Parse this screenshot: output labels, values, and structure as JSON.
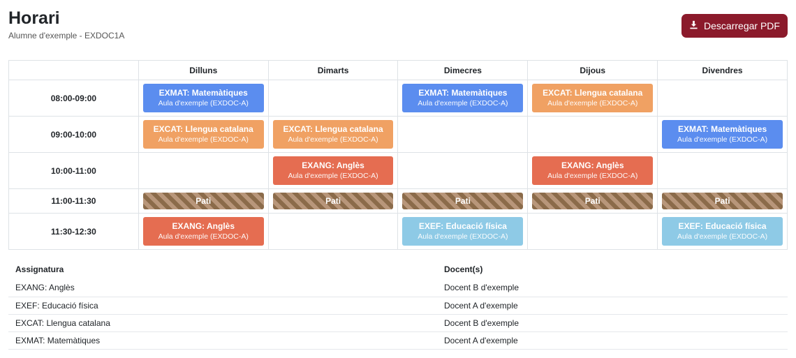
{
  "header": {
    "title": "Horari",
    "subtitle": "Alumne d'exemple - EXDOC1A",
    "download_label": "Descarregar PDF"
  },
  "days": [
    "Dilluns",
    "Dimarts",
    "Dimecres",
    "Dijous",
    "Divendres"
  ],
  "times": [
    "08:00-09:00",
    "09:00-10:00",
    "10:00-11:00",
    "11:00-11:30",
    "11:30-12:30"
  ],
  "cells": [
    [
      {
        "subject": "EXMAT: Matemàtiques",
        "room": "Aula d'exemple (EXDOC-A)"
      },
      null,
      {
        "subject": "EXMAT: Matemàtiques",
        "room": "Aula d'exemple (EXDOC-A)"
      },
      {
        "subject": "EXCAT: Llengua catalana",
        "room": "Aula d'exemple (EXDOC-A)"
      },
      null
    ],
    [
      {
        "subject": "EXCAT: Llengua catalana",
        "room": "Aula d'exemple (EXDOC-A)"
      },
      {
        "subject": "EXCAT: Llengua catalana",
        "room": "Aula d'exemple (EXDOC-A)"
      },
      null,
      null,
      {
        "subject": "EXMAT: Matemàtiques",
        "room": "Aula d'exemple (EXDOC-A)"
      }
    ],
    [
      null,
      {
        "subject": "EXANG: Anglès",
        "room": "Aula d'exemple (EXDOC-A)"
      },
      null,
      {
        "subject": "EXANG: Anglès",
        "room": "Aula d'exemple (EXDOC-A)"
      },
      null
    ],
    [
      {
        "break_label": "Pati"
      },
      {
        "break_label": "Pati"
      },
      {
        "break_label": "Pati"
      },
      {
        "break_label": "Pati"
      },
      {
        "break_label": "Pati"
      }
    ],
    [
      {
        "subject": "EXANG: Anglès",
        "room": "Aula d'exemple (EXDOC-A)"
      },
      null,
      {
        "subject": "EXEF: Educació física",
        "room": "Aula d'exemple (EXDOC-A)"
      },
      null,
      {
        "subject": "EXEF: Educació física",
        "room": "Aula d'exemple (EXDOC-A)"
      }
    ]
  ],
  "colors": {
    "EXMAT": "#5b8def",
    "EXCAT": "#f0a163",
    "EXANG": "#e56d51",
    "EXEF": "#8ecae6",
    "button": "#8b1a2b"
  },
  "teachers_table": {
    "headers": [
      "Assignatura",
      "Docent(s)"
    ],
    "rows": [
      [
        "EXANG: Anglès",
        "Docent B d'exemple"
      ],
      [
        "EXEF: Educació física",
        "Docent A d'exemple"
      ],
      [
        "EXCAT: Llengua catalana",
        "Docent B d'exemple"
      ],
      [
        "EXMAT: Matemàtiques",
        "Docent A d'exemple"
      ]
    ]
  }
}
